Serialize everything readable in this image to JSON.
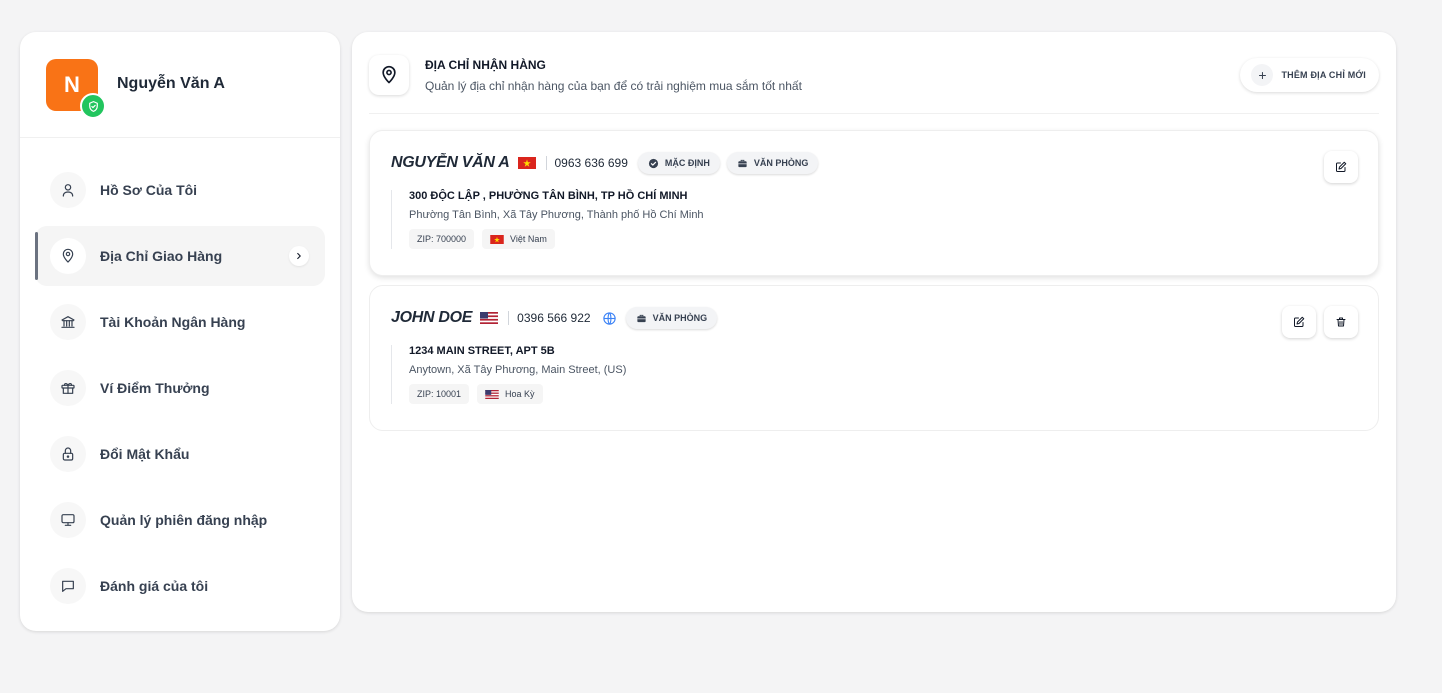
{
  "profile": {
    "avatar_initial": "N",
    "name": "Nguyễn Văn A"
  },
  "menu": [
    {
      "label": "Hồ Sơ Của Tôi",
      "icon": "user-icon"
    },
    {
      "label": "Địa Chỉ Giao Hàng",
      "icon": "map-pin-icon",
      "active": true
    },
    {
      "label": "Tài Khoản Ngân Hàng",
      "icon": "bank-icon"
    },
    {
      "label": "Ví Điểm Thưởng",
      "icon": "gift-icon"
    },
    {
      "label": "Đổi Mật Khẩu",
      "icon": "lock-icon"
    },
    {
      "label": "Quản lý phiên đăng nhập",
      "icon": "monitor-icon"
    },
    {
      "label": "Đánh giá của tôi",
      "icon": "message-icon"
    }
  ],
  "header": {
    "title": "ĐỊA CHỈ NHẬN HÀNG",
    "subtitle": "Quản lý địa chỉ nhận hàng của bạn để có trải nghiệm mua sắm tốt nhất",
    "add_button": "THÊM ĐỊA CHỈ MỚI"
  },
  "addresses": [
    {
      "name": "NGUYỄN VĂN A",
      "flag": "vn-flag-icon",
      "phone": "0963 636 699",
      "tag_default": "MẶC ĐỊNH",
      "tag_type": "VĂN PHÒNG",
      "line1": "300 ĐỘC LẬP , PHƯỜNG TÂN BÌNH, TP HỒ CHÍ MINH",
      "line2": "Phường Tân Bình, Xã Tây Phương, Thành phố Hồ Chí Minh",
      "zip": "ZIP: 700000",
      "country": "Việt Nam"
    },
    {
      "name": "JOHN DOE",
      "flag": "us-flag-icon",
      "phone": "0396 566 922",
      "tag_type": "VĂN PHÒNG",
      "line1": "1234 MAIN STREET, APT 5B",
      "line2": "Anytown, Xã Tây Phương, Main Street, (US)",
      "zip": "ZIP: 10001",
      "country": "Hoa Kỳ"
    }
  ],
  "colors": {
    "avatar": "#f97316",
    "verified": "#22c55e",
    "globe": "#3b82f6"
  }
}
